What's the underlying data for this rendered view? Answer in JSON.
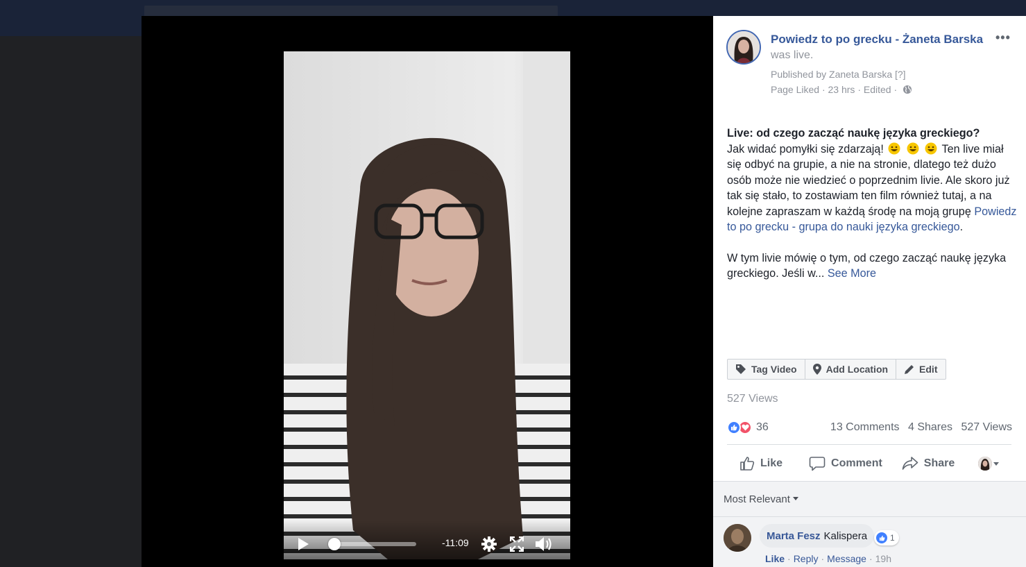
{
  "video": {
    "time_remaining": "-11:09",
    "progress_percent": 8
  },
  "post": {
    "page_name": "Powiedz to po grecku - Żaneta Barska",
    "more_label": "•••",
    "status": "was live.",
    "published_by": "Published by Zaneta Barska",
    "published_help": "[?]",
    "page_liked": "Page Liked",
    "time": "23 hrs",
    "edited": "Edited",
    "sep": "·",
    "title": "Live: od czego zacząć naukę języka greckiego?",
    "body_part1": "Jak widać pomyłki się zdarzają!",
    "body_part2": "Ten live miał się odbyć na grupie, a nie na stronie, dlatego też dużo osób może nie wiedzieć o poprzednim livie. Ale skoro już tak się stało, to zostawiam ten film również tutaj, a na kolejne zapraszam w każdą środę na moją grupę",
    "group_link": "Powiedz to po grecku - grupa do nauki języka greckiego",
    "body_period": ".",
    "para2": "W tym livie mówię o tym, od czego zacząć naukę języka greckiego. Jeśli w...",
    "see_more": "See More",
    "emoji_color": "#f7c600"
  },
  "tag_bar": {
    "tag_video": "Tag Video",
    "add_location": "Add Location",
    "edit": "Edit"
  },
  "views": "527 Views",
  "reactions": {
    "count": "36",
    "comments": "13 Comments",
    "shares": "4 Shares",
    "views": "527 Views"
  },
  "actions": {
    "like": "Like",
    "comment": "Comment",
    "share": "Share"
  },
  "comments": {
    "sort_label": "Most Relevant",
    "items": [
      {
        "name": "Marta Fesz",
        "text": "Kalispera",
        "reaction_count": "1",
        "like": "Like",
        "reply": "Reply",
        "message": "Message",
        "time": "19h"
      }
    ]
  },
  "colors": {
    "link": "#365899",
    "like_blue": "#4080ff",
    "love_red": "#f25268",
    "topbar": "#1a2338"
  }
}
